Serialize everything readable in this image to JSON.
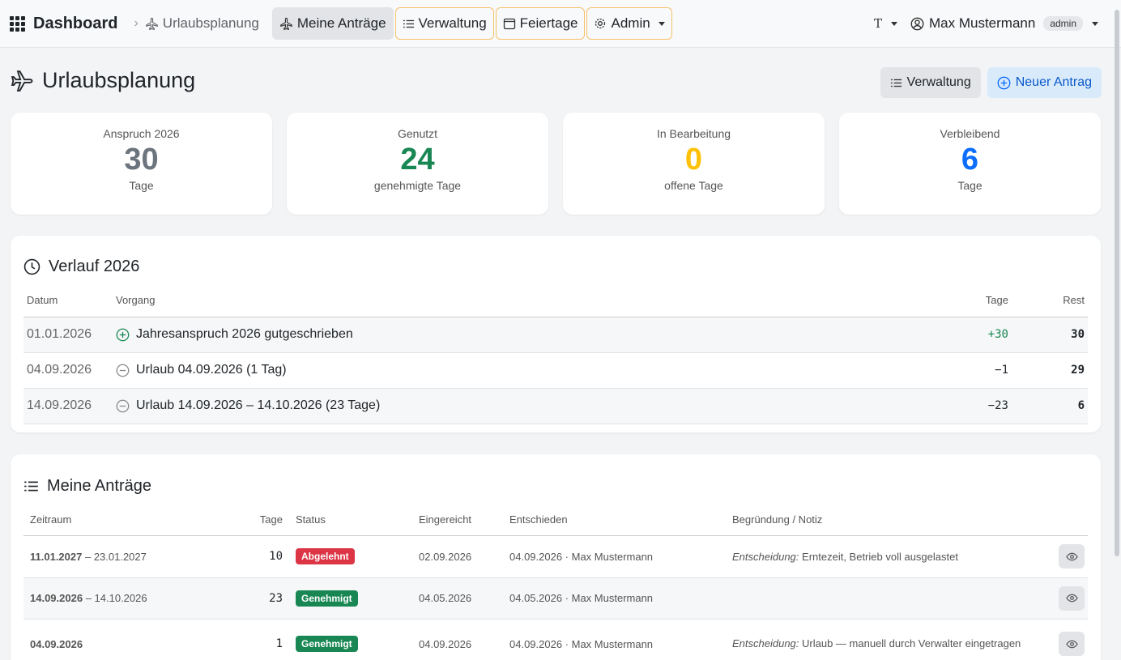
{
  "nav": {
    "brand": "Dashboard",
    "breadcrumb": "Urlaubsplanung",
    "items": [
      {
        "label": "Meine Anträge"
      },
      {
        "label": "Verwaltung"
      },
      {
        "label": "Feiertage"
      },
      {
        "label": "Admin"
      }
    ],
    "font_toggle": "T",
    "user_name": "Max Mustermann",
    "user_role": "admin"
  },
  "page": {
    "title": "Urlaubsplanung",
    "btn_verwaltung": "Verwaltung",
    "btn_new": "Neuer Antrag"
  },
  "stats": [
    {
      "label": "Anspruch 2026",
      "value": "30",
      "sub": "Tage",
      "color": "#6c757d"
    },
    {
      "label": "Genutzt",
      "value": "24",
      "sub": "genehmigte Tage",
      "color": "#198754"
    },
    {
      "label": "In Bearbeitung",
      "value": "0",
      "sub": "offene Tage",
      "color": "#ffc107"
    },
    {
      "label": "Verbleibend",
      "value": "6",
      "sub": "Tage",
      "color": "#0d6efd"
    }
  ],
  "verlauf": {
    "title": "Verlauf 2026",
    "headers": {
      "date": "Datum",
      "op": "Vorgang",
      "days": "Tage",
      "rest": "Rest"
    },
    "rows": [
      {
        "date": "01.01.2026",
        "icon": "plus-circle-icon",
        "op": "Jahresanspruch 2026 gutgeschrieben",
        "days": "+30",
        "rest": "30"
      },
      {
        "date": "04.09.2026",
        "icon": "minus-circle-icon",
        "op": "Urlaub 04.09.2026 (1 Tag)",
        "days": "−1",
        "rest": "29"
      },
      {
        "date": "14.09.2026",
        "icon": "minus-circle-icon",
        "op": "Urlaub 14.09.2026 – 14.10.2026 (23 Tage)",
        "days": "−23",
        "rest": "6"
      }
    ]
  },
  "antraege": {
    "title": "Meine Anträge",
    "headers": {
      "period": "Zeitraum",
      "days": "Tage",
      "status": "Status",
      "submitted": "Eingereicht",
      "decided": "Entschieden",
      "note": "Begründung / Notiz"
    },
    "rows": [
      {
        "start": "11.01.2027",
        "end": " – 23.01.2027",
        "days": "10",
        "status": "Abgelehnt",
        "status_color": "#dc3545",
        "submitted": "02.09.2026",
        "decided": "04.09.2026 · Max Mustermann",
        "note_label": "Entscheidung:",
        "note": " Erntezeit, Betrieb voll ausgelastet"
      },
      {
        "start": "14.09.2026",
        "end": " – 14.10.2026",
        "days": "23",
        "status": "Genehmigt",
        "status_color": "#198754",
        "submitted": "04.05.2026",
        "decided": "04.05.2026 · Max Mustermann",
        "note_label": "",
        "note": ""
      },
      {
        "start": "04.09.2026",
        "end": "",
        "days": "1",
        "status": "Genehmigt",
        "status_color": "#198754",
        "submitted": "04.09.2026",
        "decided": "04.09.2026 · Max Mustermann",
        "note_label": "Entscheidung:",
        "note": " Urlaub — manuell durch Verwalter eingetragen"
      }
    ]
  }
}
